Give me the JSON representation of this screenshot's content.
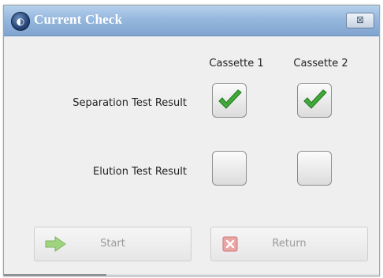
{
  "window": {
    "title": "Current Check",
    "close_symbol": "⊠"
  },
  "columns": [
    "Cassette 1",
    "Cassette 2"
  ],
  "rows": [
    {
      "label": "Separation Test Result",
      "checked": [
        true,
        true
      ]
    },
    {
      "label": "Elution Test Result",
      "checked": [
        false,
        false
      ]
    }
  ],
  "buttons": {
    "start": {
      "label": "Start",
      "icon": "green-arrow-right-icon",
      "enabled": false
    },
    "return": {
      "label": "Return",
      "icon": "red-x-icon",
      "enabled": false
    }
  },
  "colors": {
    "title_bar": "#96b8de",
    "check_green": "#3fa93a",
    "disabled_text": "#9a9a9a"
  }
}
